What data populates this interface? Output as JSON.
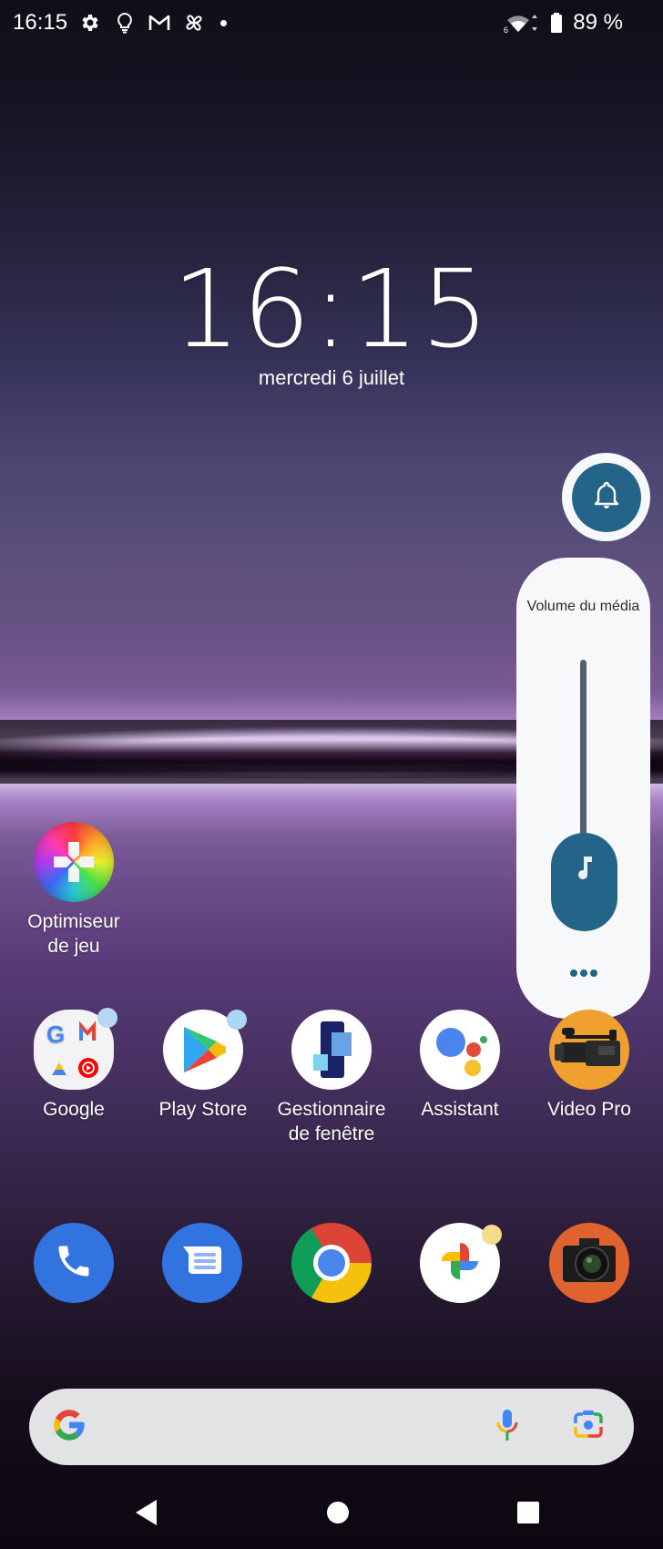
{
  "status_bar": {
    "time": "16:15",
    "notification_icons": [
      "settings-icon",
      "lightbulb-icon",
      "gmail-icon",
      "pinwheel-icon",
      "more-notifications-dot"
    ],
    "wifi_label": "6",
    "battery_percent": "89 %"
  },
  "lockscreen_clock": {
    "time": "16:15",
    "date": "mercredi 6 juillet"
  },
  "volume_panel": {
    "ringer_mode_icon": "bell-icon",
    "label": "Volume du média",
    "stream_icon": "music-note-icon",
    "level_fraction": 0,
    "more_options_icon": "more-horiz-icon",
    "accent_color": "#256489"
  },
  "home": {
    "standalone_apps": [
      {
        "label": "Optimiseur\nde jeu",
        "label_line1": "Optimiseur",
        "label_line2": "de jeu",
        "icon": "game-controller-icon"
      }
    ],
    "app_row": [
      {
        "label": "Google",
        "icon": "google-folder-icon",
        "type": "folder",
        "folder_apps": [
          "Google",
          "Gmail",
          "Drive",
          "YouTube Music"
        ],
        "has_badge": true
      },
      {
        "label": "Play Store",
        "icon": "play-store-icon",
        "has_badge": true
      },
      {
        "label_line1": "Gestionnaire",
        "label_line2": "de fenêtre",
        "icon": "window-manager-icon",
        "has_badge": false
      },
      {
        "label": "Assistant",
        "icon": "assistant-icon",
        "has_badge": false
      },
      {
        "label": "Video Pro",
        "icon": "video-camera-icon",
        "has_badge": false
      }
    ],
    "dock": [
      {
        "name": "Phone",
        "icon": "phone-icon"
      },
      {
        "name": "Messages",
        "icon": "messages-icon"
      },
      {
        "name": "Chrome",
        "icon": "chrome-icon"
      },
      {
        "name": "Photos",
        "icon": "photos-icon",
        "has_badge": true
      },
      {
        "name": "Camera",
        "icon": "camera-icon"
      }
    ]
  },
  "search_bar": {
    "logo": "google-g-icon",
    "placeholder": "",
    "voice_icon": "microphone-icon",
    "lens_icon": "google-lens-icon"
  },
  "nav_bar": {
    "back": "back-icon",
    "home": "home-icon",
    "recents": "recents-icon"
  }
}
